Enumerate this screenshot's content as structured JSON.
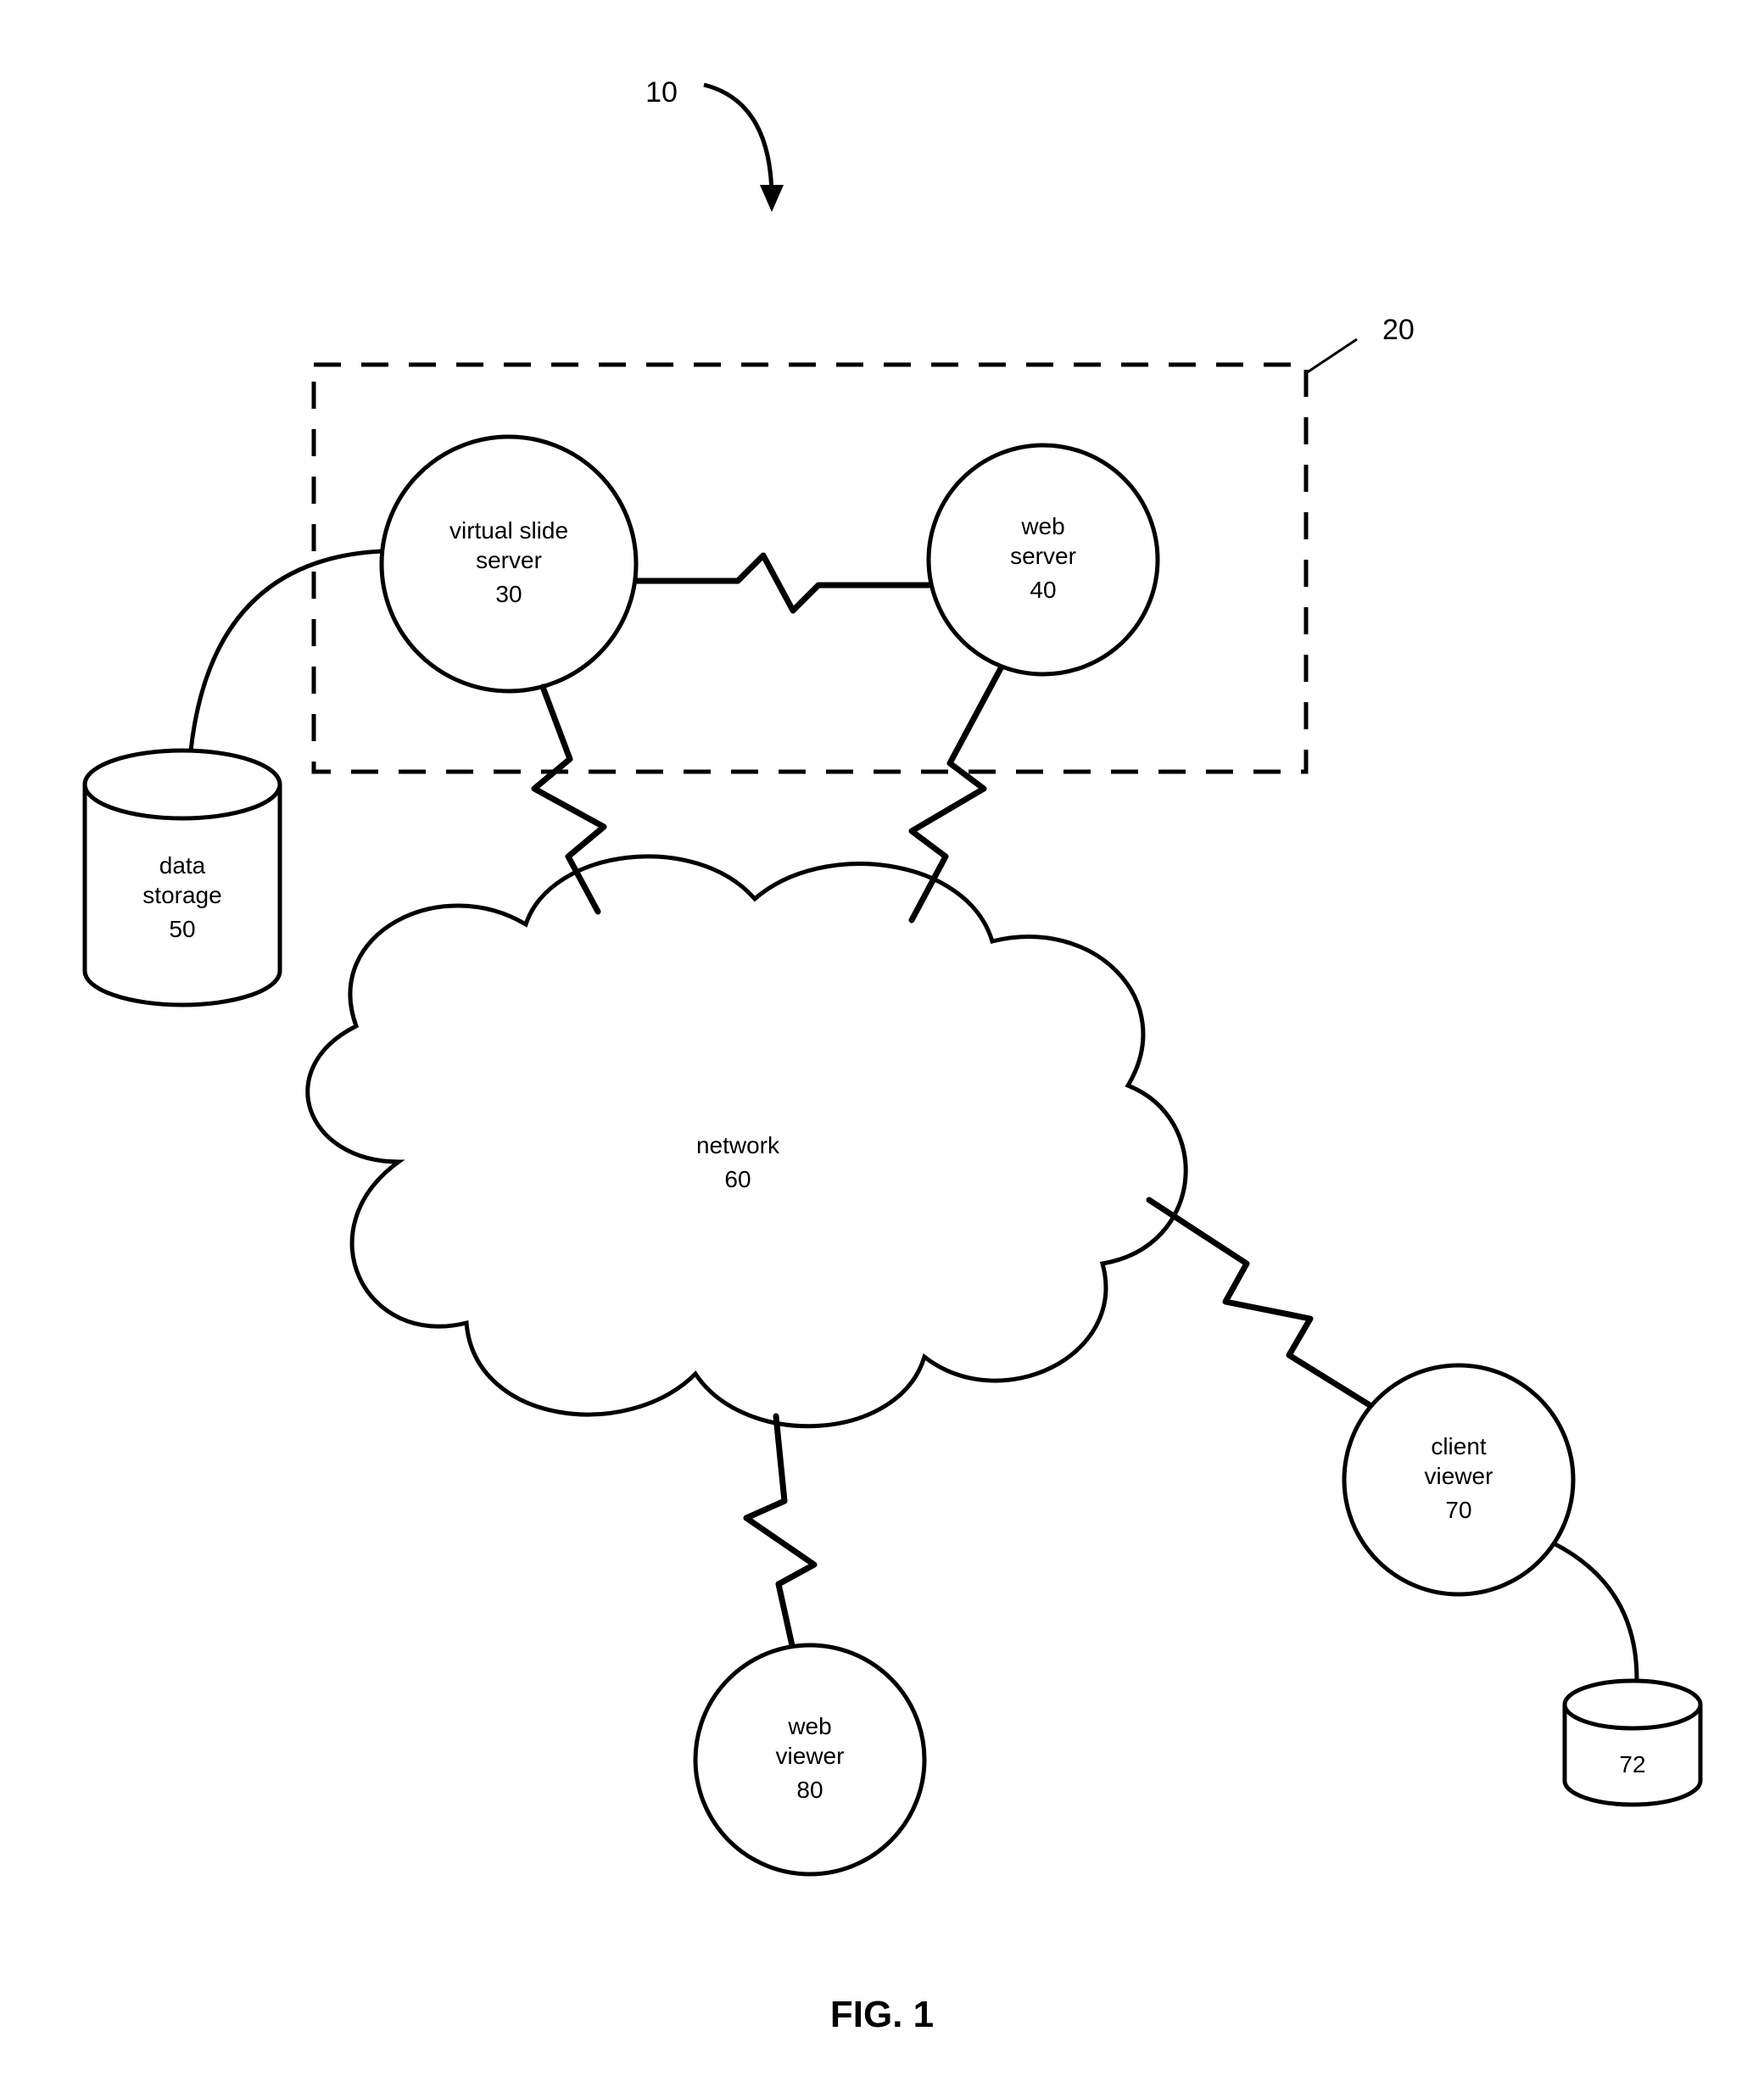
{
  "figure_title": "FIG. 1",
  "refs": {
    "overall": "10",
    "server_group": "20"
  },
  "nodes": {
    "virtual_slide_server": {
      "label": "virtual slide server",
      "num": "30",
      "line1": "virtual slide",
      "line2": "server"
    },
    "web_server": {
      "label": "web server",
      "num": "40",
      "line1": "web",
      "line2": "server"
    },
    "data_storage": {
      "label": "data storage",
      "num": "50",
      "line1": "data",
      "line2": "storage"
    },
    "network": {
      "label": "network",
      "num": "60"
    },
    "client_viewer": {
      "label": "client viewer",
      "num": "70",
      "line1": "client",
      "line2": "viewer"
    },
    "client_storage": {
      "label": "",
      "num": "72"
    },
    "web_viewer": {
      "label": "web viewer",
      "num": "80",
      "line1": "web",
      "line2": "viewer"
    }
  },
  "connections": [
    {
      "from": "virtual_slide_server",
      "to": "web_server",
      "style": "zigzag"
    },
    {
      "from": "data_storage",
      "to": "virtual_slide_server",
      "style": "curve"
    },
    {
      "from": "virtual_slide_server",
      "to": "network",
      "style": "zigzag"
    },
    {
      "from": "web_server",
      "to": "network",
      "style": "zigzag"
    },
    {
      "from": "network",
      "to": "client_viewer",
      "style": "zigzag"
    },
    {
      "from": "network",
      "to": "web_viewer",
      "style": "zigzag"
    },
    {
      "from": "client_viewer",
      "to": "client_storage",
      "style": "curve"
    }
  ]
}
